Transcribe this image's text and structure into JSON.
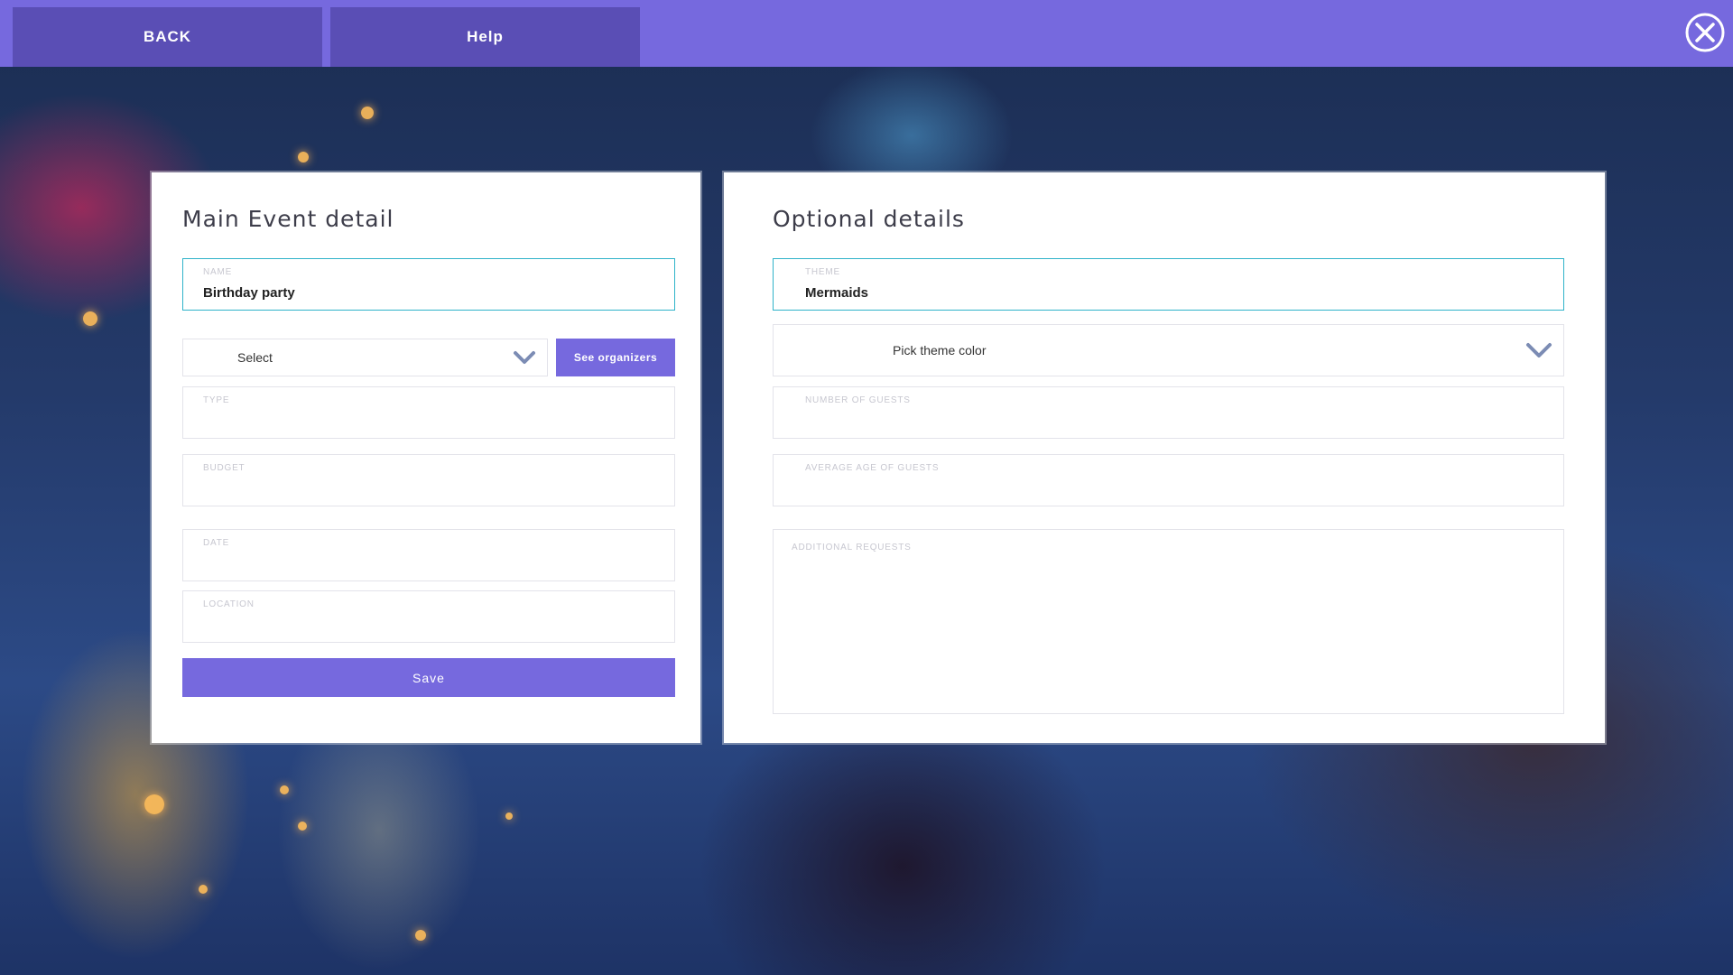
{
  "topbar": {
    "back_label": "BACK",
    "help_label": "Help",
    "close_icon": "close-circle-icon"
  },
  "main_panel": {
    "title": "Main Event detail",
    "name": {
      "label": "NAME",
      "value": "Birthday party"
    },
    "organizer_select": {
      "value": "Select",
      "icon": "chevron-down-icon"
    },
    "see_organizers_label": "See organizers",
    "type": {
      "label": "TYPE",
      "value": ""
    },
    "budget": {
      "label": "BUDGET",
      "value": ""
    },
    "date": {
      "label": "DATE",
      "value": ""
    },
    "location": {
      "label": "LOCATION",
      "value": ""
    },
    "save_label": "Save"
  },
  "optional_panel": {
    "title": "Optional details",
    "theme": {
      "label": "THEME",
      "value": "Mermaids"
    },
    "theme_color_select": {
      "value": "Pick theme color",
      "icon": "chevron-down-icon"
    },
    "number_of_guests": {
      "label": "NUMBER OF GUESTS",
      "value": ""
    },
    "average_age": {
      "label": "AVERAGE AGE OF GUESTS",
      "value": ""
    },
    "additional_requests": {
      "label": "ADDITIONAL REQUESTS",
      "value": ""
    }
  },
  "colors": {
    "accent": "#7669de",
    "accent_dark": "#5a4eb5",
    "active_border": "#2fb3c9"
  }
}
